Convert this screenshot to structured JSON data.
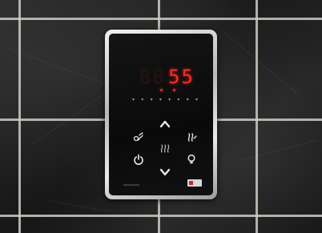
{
  "photo": {
    "subject": "sauna control panel",
    "wall_colors": {
      "tile": "#1e1e1e",
      "grout": "#cfcac2"
    },
    "panel_colors": {
      "frame": "#c8c8c8",
      "face": "#0d0d0d",
      "display": "#ff2b22"
    }
  },
  "display": {
    "inactive_digits": "88",
    "temperature_value": "55"
  },
  "indicators": {
    "symbols": [
      "▾",
      "▾",
      "▾",
      "▾",
      "▾",
      "▾",
      "▾",
      "▾"
    ]
  },
  "buttons": {
    "up_icon": "chevron-up-icon",
    "down_icon": "chevron-down-icon",
    "power_icon": "power-icon",
    "light_icon": "light-bulb-icon",
    "fan_icon": "fan-icon",
    "heat_icon": "heat-waves-icon",
    "steam_icon": "steam-icon",
    "timer_icon": "timer-icon"
  }
}
